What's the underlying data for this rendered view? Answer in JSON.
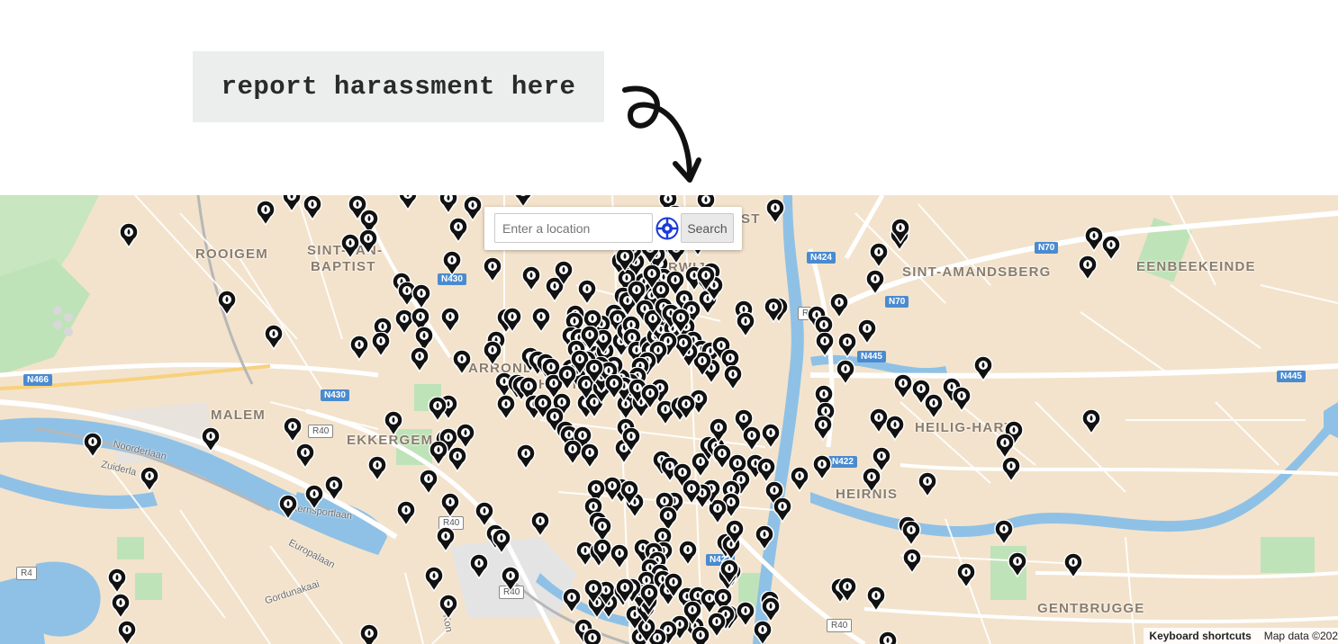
{
  "banner": {
    "text": "report harassment here"
  },
  "search": {
    "placeholder": "Enter a location",
    "button_label": "Search"
  },
  "attribution": {
    "shortcuts": "Keyboard shortcuts",
    "map_data": "Map data ©202"
  },
  "labels": {
    "rooigem": "ROOIGEM",
    "sint_jan": "SINT-JAN-",
    "baptist": "BAPTIST",
    "sint_amandsberg": "SINT-AMANDSBERG",
    "eenbeekeinde": "EENBEEKEINDE",
    "malem": "MALEM",
    "ekkergem": "EKKERGEM",
    "heilig_hart": "HEILIG-HART",
    "heirnis": "HEIRNIS",
    "gentbrugge": "GENTBRUGGE",
    "rwijk": "RWIJK",
    "arkonde": "ARRONDE",
    "st": "ST",
    "hent": "HENT"
  },
  "streets": {
    "noorderlaan": "Noorderlaan",
    "zuiderlaan": "Zuiderla",
    "sportlaan": "Internsportlaan",
    "europalaan": "Europalaan",
    "gordunakaai": "Gordunakaai",
    "kon": "Kon"
  },
  "road_shields": {
    "n430_a": "N430",
    "n430_b": "N430",
    "n466": "N466",
    "r40_a": "R40",
    "r40_b": "R40",
    "r40_c": "R40",
    "r40_d": "R40",
    "r4": "R4",
    "n424": "N424",
    "n70_a": "N70",
    "n70_b": "N70",
    "n445_a": "N445",
    "n445_b": "N445",
    "n422_a": "N422",
    "n422_b": "N422",
    "r_small": "R"
  },
  "map_colors": {
    "land": "#f3e3cc",
    "water": "#8fc1e6",
    "park": "#bfe3b8",
    "road": "#ffffff",
    "major_road": "#f8d17c",
    "rail": "#b7b7b7"
  }
}
